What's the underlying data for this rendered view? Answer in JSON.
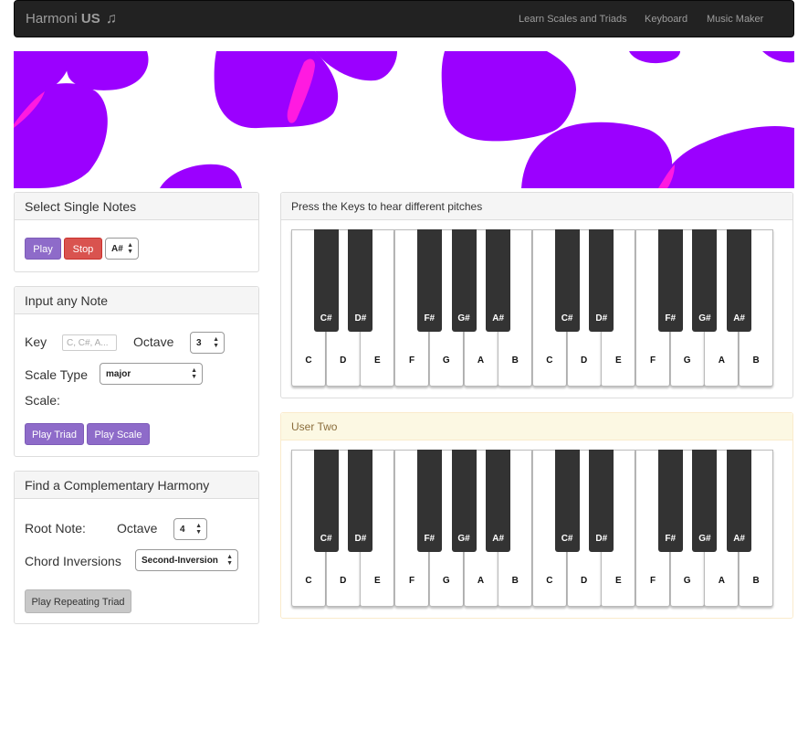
{
  "navbar": {
    "brand_prefix": "Harmoni",
    "brand_bold": "US",
    "brand_icon": "♫",
    "links": [
      "Learn Scales and Triads",
      "Keyboard",
      "Music Maker"
    ]
  },
  "colors": {
    "accent": "#9b00ff",
    "highlight": "#ff1ae0",
    "purple_button": "#8e6bc9",
    "stop_button": "#d9534f",
    "navbar": "#222222"
  },
  "single_notes": {
    "title": "Select Single Notes",
    "play": "Play",
    "stop": "Stop",
    "note_value": "A#"
  },
  "input_note": {
    "title": "Input any Note",
    "key_label": "Key",
    "key_placeholder": "C, C#, A...",
    "octave_label": "Octave",
    "octave_value": "3",
    "scale_type_label": "Scale Type",
    "scale_type_value": "major",
    "scale_label": "Scale:",
    "play_triad": "Play Triad",
    "play_scale": "Play Scale"
  },
  "harmony": {
    "title": "Find a Complementary Harmony",
    "root_label": "Root Note:",
    "octave_label": "Octave",
    "octave_value": "4",
    "inversions_label": "Chord Inversions",
    "inversion_value": "Second-Inversion",
    "play_repeating": "Play Repeating Triad"
  },
  "keyboard1": {
    "title": "Press the Keys to hear different pitches"
  },
  "keyboard2": {
    "title": "User Two"
  },
  "keys": {
    "white": [
      "C",
      "D",
      "E",
      "F",
      "G",
      "A",
      "B",
      "C",
      "D",
      "E",
      "F",
      "G",
      "A",
      "B"
    ],
    "black": [
      "C#",
      "D#",
      "F#",
      "G#",
      "A#",
      "C#",
      "D#",
      "F#",
      "G#",
      "A#"
    ]
  }
}
